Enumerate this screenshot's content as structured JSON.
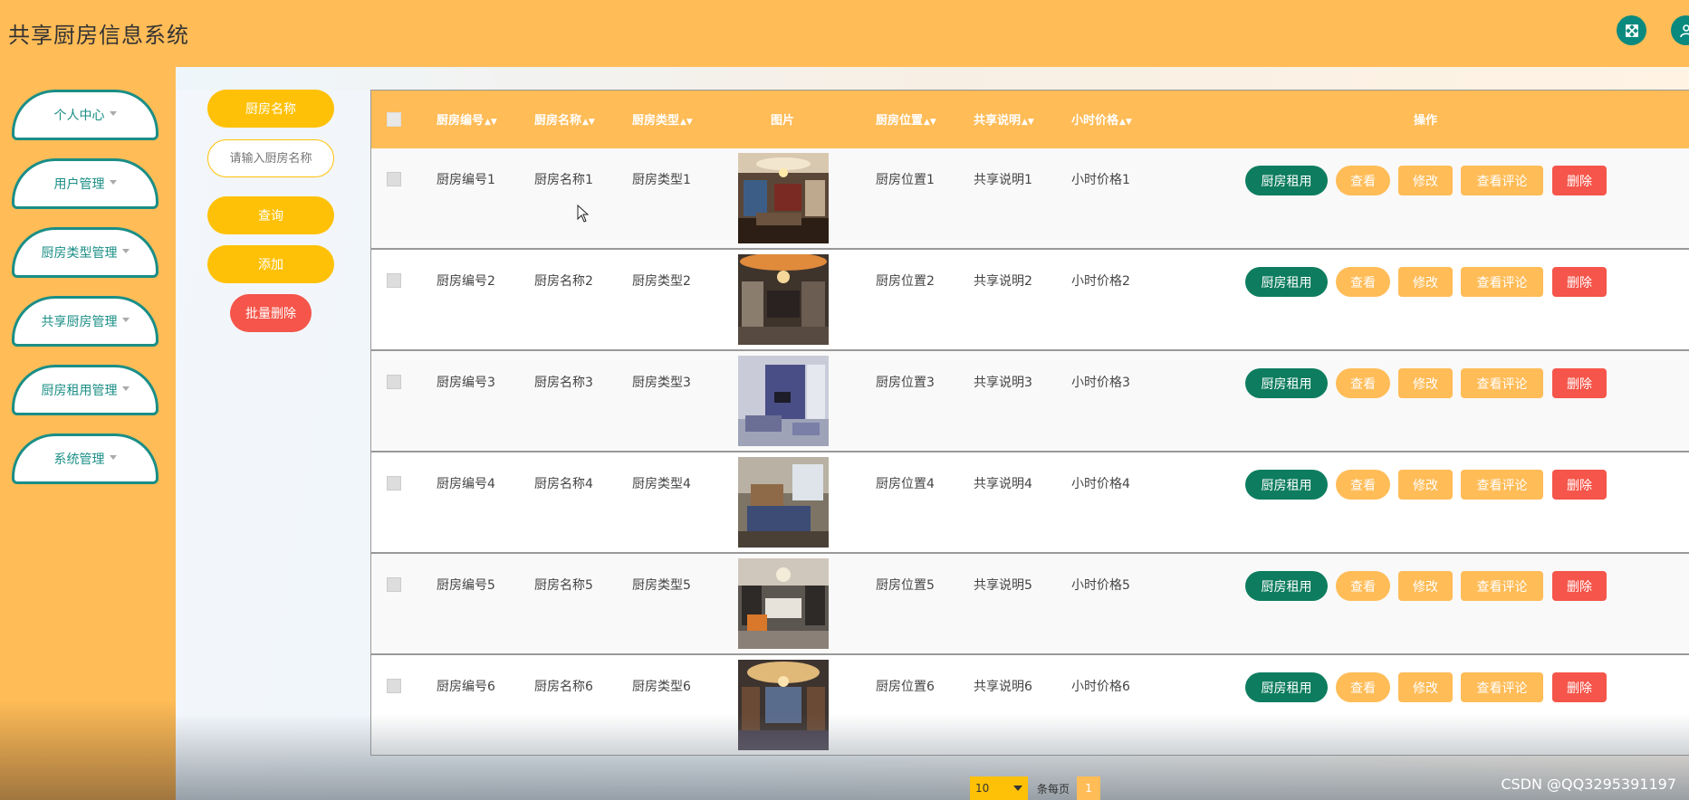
{
  "app": {
    "title": "共享厨房信息系统"
  },
  "header": {
    "fullscreen_icon": "expand-icon",
    "user_icon": "user-icon"
  },
  "sidebar": {
    "items": [
      {
        "label": "个人中心"
      },
      {
        "label": "用户管理"
      },
      {
        "label": "厨房类型管理"
      },
      {
        "label": "共享厨房管理"
      },
      {
        "label": "厨房租用管理"
      },
      {
        "label": "系统管理"
      }
    ]
  },
  "search": {
    "field_label": "厨房名称",
    "placeholder": "请输入厨房名称",
    "query_button": "查询",
    "add_button": "添加",
    "batch_delete_button": "批量删除"
  },
  "table": {
    "columns": [
      "厨房编号",
      "厨房名称",
      "厨房类型",
      "图片",
      "厨房位置",
      "共享说明",
      "小时价格",
      "操作"
    ],
    "actions": {
      "rent": "厨房租用",
      "view": "查看",
      "edit": "修改",
      "review": "查看评论",
      "delete": "删除"
    },
    "rows": [
      {
        "code": "厨房编号1",
        "name": "厨房名称1",
        "type": "厨房类型1",
        "location": "厨房位置1",
        "desc": "共享说明1",
        "price": "小时价格1"
      },
      {
        "code": "厨房编号2",
        "name": "厨房名称2",
        "type": "厨房类型2",
        "location": "厨房位置2",
        "desc": "共享说明2",
        "price": "小时价格2"
      },
      {
        "code": "厨房编号3",
        "name": "厨房名称3",
        "type": "厨房类型3",
        "location": "厨房位置3",
        "desc": "共享说明3",
        "price": "小时价格3"
      },
      {
        "code": "厨房编号4",
        "name": "厨房名称4",
        "type": "厨房类型4",
        "location": "厨房位置4",
        "desc": "共享说明4",
        "price": "小时价格4"
      },
      {
        "code": "厨房编号5",
        "name": "厨房名称5",
        "type": "厨房类型5",
        "location": "厨房位置5",
        "desc": "共享说明5",
        "price": "小时价格5"
      },
      {
        "code": "厨房编号6",
        "name": "厨房名称6",
        "type": "厨房类型6",
        "location": "厨房位置6",
        "desc": "共享说明6",
        "price": "小时价格6"
      }
    ]
  },
  "pagination": {
    "page_size": "10",
    "per_page_label": "条每页",
    "current_page": "1"
  },
  "watermark": "CSDN @QQ3295391197",
  "colors": {
    "header": "#FFBC57",
    "accent_teal": "#1a8e86",
    "button_yellow": "#FFC107",
    "danger": "#F5554A",
    "rent_green": "#0e7d5f"
  }
}
